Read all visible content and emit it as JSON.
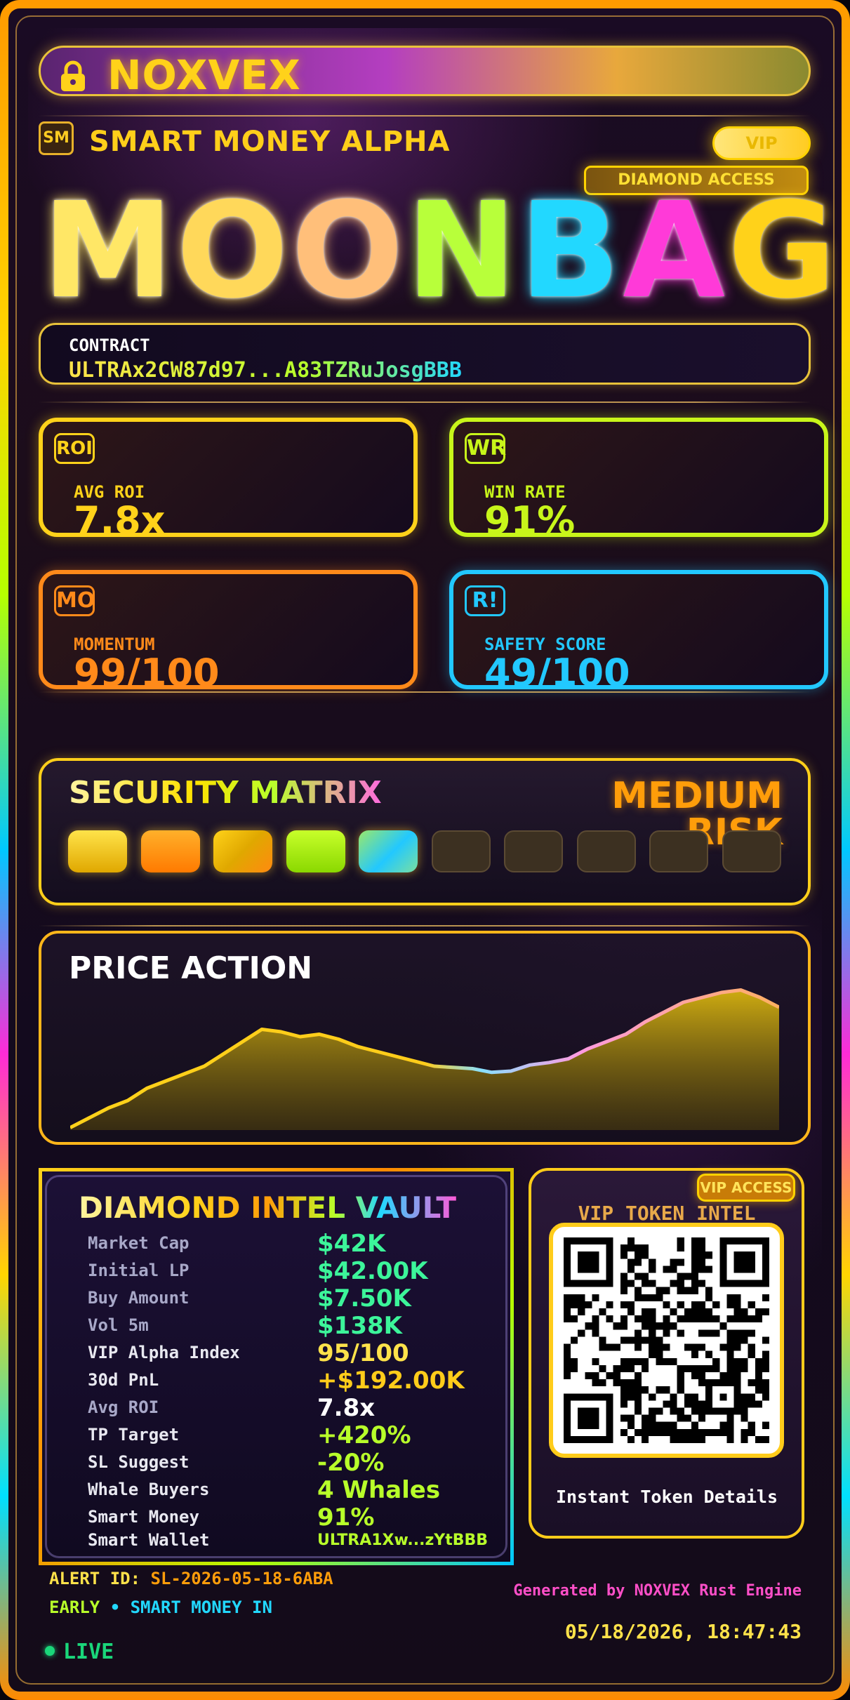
{
  "brand": {
    "name": "NOXVEX"
  },
  "header": {
    "badge": "SM",
    "title": "SMART MONEY ALPHA",
    "vip": "VIP",
    "access": "DIAMOND ACCESS"
  },
  "token": {
    "letters": [
      {
        "ch": "M",
        "color": "#ffe766"
      },
      {
        "ch": "O",
        "color": "#ffd85a"
      },
      {
        "ch": "O",
        "color": "#ffbf7a"
      },
      {
        "ch": "N",
        "color": "#b8ff3a"
      },
      {
        "ch": "B",
        "color": "#22d8ff"
      },
      {
        "ch": "A",
        "color": "#ff3ad8"
      },
      {
        "ch": "G",
        "color": "#ffd21a"
      }
    ]
  },
  "contract": {
    "label": "CONTRACT",
    "value": "ULTRAx2CW87d97...A83TZRuJosgBBB"
  },
  "stats": [
    {
      "icon": "ROI",
      "label": "AVG ROI",
      "value": "7.8x",
      "color": "#ffd21a"
    },
    {
      "icon": "WR",
      "label": "WIN RATE",
      "value": "91%",
      "color": "#c8f51a"
    },
    {
      "icon": "MO",
      "label": "MOMENTUM",
      "value": "99/100",
      "color": "#ff8a1a"
    },
    {
      "icon": "R!",
      "label": "SAFETY SCORE",
      "value": "49/100",
      "color": "#22c8ff"
    }
  ],
  "security": {
    "title": "SECURITY MATRIX",
    "risk": "MEDIUM RISK",
    "level": 5,
    "total": 10
  },
  "price": {
    "title": "PRICE ACTION",
    "series": [
      2,
      10,
      18,
      24,
      34,
      40,
      46,
      52,
      62,
      72,
      82,
      80,
      76,
      78,
      74,
      68,
      64,
      60,
      56,
      52,
      51,
      50,
      47,
      48,
      53,
      55,
      58,
      66,
      72,
      78,
      88,
      96,
      104,
      108,
      112,
      114,
      108,
      100
    ]
  },
  "vault": {
    "title": "DIAMOND INTEL VAULT",
    "rows": [
      {
        "label": "Market Cap",
        "value": "$42K",
        "color": "#3cf59a",
        "lcolor": "#a8a8c8"
      },
      {
        "label": "Initial LP",
        "value": "$42.00K",
        "color": "#3cf59a",
        "lcolor": "#a8a8c8"
      },
      {
        "label": "Buy Amount",
        "value": "$7.50K",
        "color": "#3cf59a",
        "lcolor": "#a8a8c8"
      },
      {
        "label": "Vol 5m",
        "value": "$138K",
        "color": "#3cf59a",
        "lcolor": "#a8a8c8"
      },
      {
        "label": "VIP Alpha Index",
        "value": "95/100",
        "color": "#ffe24a",
        "lcolor": "#e8e8f0"
      },
      {
        "label": "30d PnL",
        "value": "+$192.00K",
        "color": "#ffcc1a",
        "lcolor": "#e8e8f0"
      },
      {
        "label": "Avg ROI",
        "value": "7.8x",
        "color": "#ffffff",
        "lcolor": "#a8a8c8"
      },
      {
        "label": "TP Target",
        "value": "+420%",
        "color": "#b8ff2a",
        "lcolor": "#e8e8f0"
      },
      {
        "label": "SL Suggest",
        "value": "-20%",
        "color": "#b8ff2a",
        "lcolor": "#e8e8f0"
      },
      {
        "label": "Whale Buyers",
        "value": "4 Whales",
        "color": "#b8ff2a",
        "lcolor": "#e8e8f0"
      },
      {
        "label": "Smart Money",
        "value": "91%",
        "color": "#b8ff2a",
        "lcolor": "#e8e8f0"
      },
      {
        "label": "Smart Wallet",
        "value": "ULTRA1Xw...zYtBBB",
        "color": "#b8ff2a",
        "lcolor": "#e8e8f0"
      }
    ]
  },
  "qr": {
    "badge": "VIP ACCESS",
    "title": "VIP TOKEN INTEL",
    "caption": "Instant Token Details"
  },
  "footer": {
    "alert_label": "ALERT ID: ",
    "alert_value": "SL-2026-05-18-6ABA",
    "early": "EARLY",
    "bullet": "•",
    "smart": "SMART MONEY IN",
    "generated": "Generated by NOXVEX Rust Engine",
    "timestamp": "05/18/2026, 18:47:43",
    "live": "LIVE"
  },
  "colors": {
    "accent": "#ffd21a",
    "live": "#1ad67a"
  }
}
